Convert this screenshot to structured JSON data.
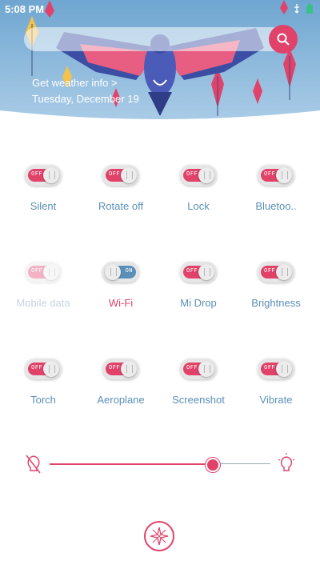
{
  "status_bar": {
    "time": "5:08 PM"
  },
  "header": {
    "weather_link": "Get weather info >",
    "date": "Tuesday, December 19"
  },
  "toggles": [
    {
      "label": "Silent",
      "state_text": "OFF",
      "state": "off"
    },
    {
      "label": "Rotate off",
      "state_text": "OFF",
      "state": "off"
    },
    {
      "label": "Lock",
      "state_text": "OFF",
      "state": "off"
    },
    {
      "label": "Bluetoo..",
      "state_text": "OFF",
      "state": "off"
    },
    {
      "label": "Mobile data",
      "state_text": "OFF",
      "state": "disabled"
    },
    {
      "label": "Wi-Fi",
      "state_text": "ON",
      "state": "on"
    },
    {
      "label": "Mi Drop",
      "state_text": "OFF",
      "state": "off"
    },
    {
      "label": "Brightness",
      "state_text": "OFF",
      "state": "off"
    },
    {
      "label": "Torch",
      "state_text": "OFF",
      "state": "off"
    },
    {
      "label": "Aeroplane",
      "state_text": "OFF",
      "state": "off"
    },
    {
      "label": "Screenshot",
      "state_text": "OFF",
      "state": "off"
    },
    {
      "label": "Vibrate",
      "state_text": "OFF",
      "state": "off"
    }
  ],
  "brightness": {
    "level": 0.74
  },
  "colors": {
    "accent": "#e1426a",
    "label_blue": "#5b8fb9",
    "header_blue": "#7fb3d9"
  },
  "icons": {
    "search": "search-icon",
    "brightness_low": "brightness-low-icon",
    "brightness_high": "brightness-high-icon",
    "bottom": "compass-icon"
  }
}
